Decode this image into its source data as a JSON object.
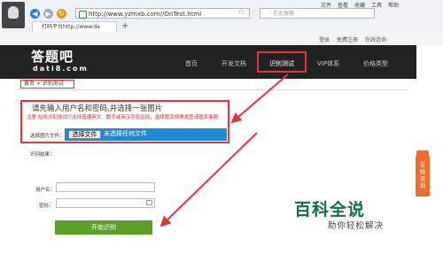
{
  "browser": {
    "menu": [
      "文件",
      "查看",
      "收藏",
      "工具",
      "帮助"
    ],
    "address": "http://www.yzmxb.com//OnTest.html",
    "search_placeholder": "在此搜索",
    "tab_title": "打码平台http://www.da"
  },
  "site": {
    "top_links": [
      "登录",
      "免费注册",
      "在线咨询"
    ],
    "logo": "答题吧",
    "logo_sub": "dati8.com",
    "nav": [
      "首页",
      "开发文档",
      "识别测试",
      "VIP体系",
      "价格类型"
    ],
    "breadcrumb": "首页 > 识别测试"
  },
  "form": {
    "prompt": "请先输入用户名和密码,并选择一张图片",
    "note": "注意 在线识别测试只支持普通英文、数字或英汉字验证码，选择题及特殊类型请联系客服",
    "file_label": "选择图片文件：",
    "file_button": "选择文件",
    "file_status": "未选择任何文件",
    "result_label": "识别结果：",
    "username_label": "用户名：",
    "password_label": "密码：",
    "submit": "开始识别"
  },
  "side_tab": "在线咨询",
  "watermark": {
    "big": "百科全说",
    "small": "助你轻松解决"
  },
  "colors": {
    "highlight": "#e3343b",
    "submit": "#5aa024",
    "file_input": "#1e89d4",
    "side_tab": "#f06b2e"
  }
}
